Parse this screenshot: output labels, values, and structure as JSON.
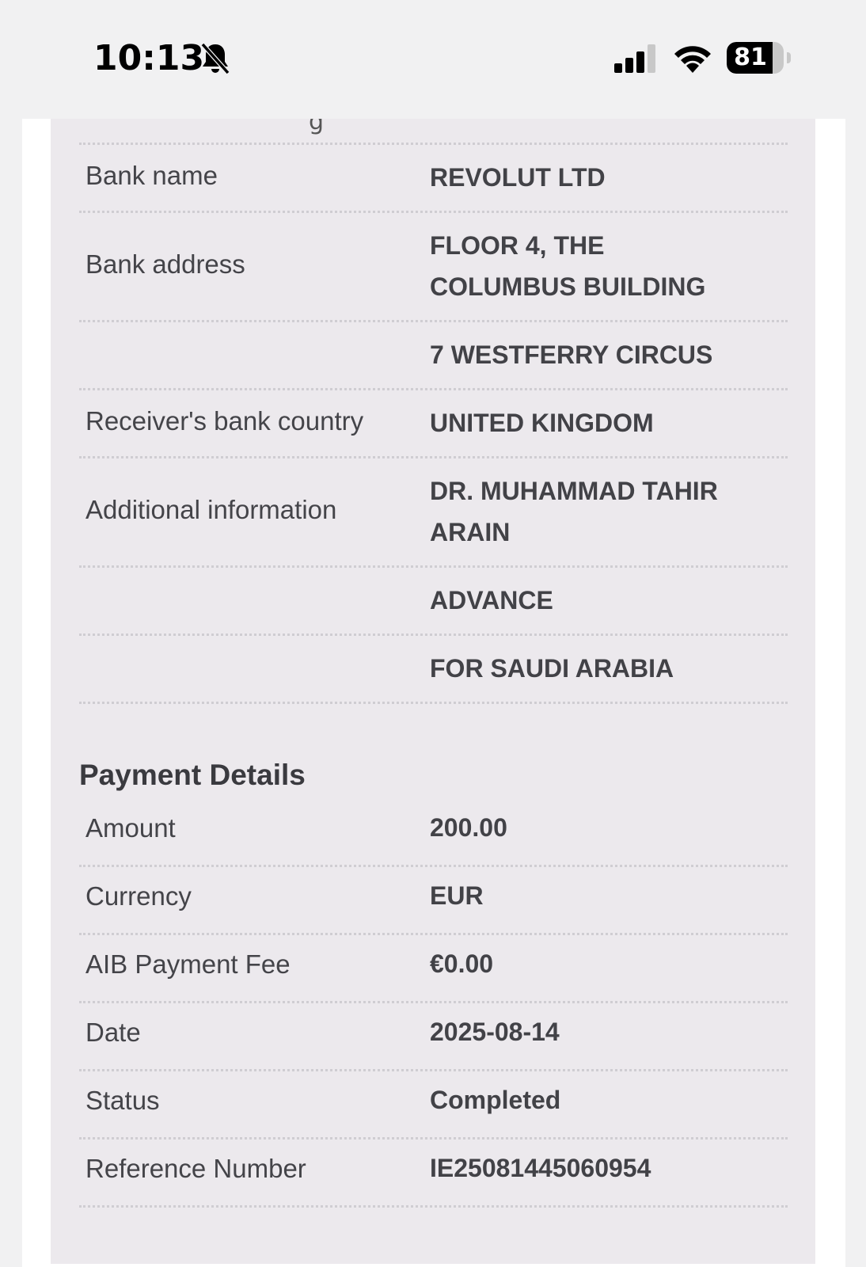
{
  "status_bar": {
    "time": "10:13",
    "battery_level": "81",
    "battery_fraction": 0.81,
    "icons": [
      "bell-off-icon",
      "signal-icon",
      "wifi-icon",
      "battery-icon"
    ]
  },
  "beneficiary_rows": [
    {
      "label": "Bank name",
      "value_lines": [
        "REVOLUT LTD"
      ]
    },
    {
      "label": "Bank address",
      "value_lines": [
        "FLOOR 4, THE",
        "COLUMBUS BUILDING"
      ]
    },
    {
      "label": "",
      "value_lines": [
        "7 WESTFERRY CIRCUS"
      ]
    },
    {
      "label": "Receiver's bank country",
      "value_lines": [
        "UNITED KINGDOM"
      ]
    },
    {
      "label": "Additional information",
      "value_lines": [
        "DR. MUHAMMAD TAHIR",
        "ARAIN"
      ]
    },
    {
      "label": "",
      "value_lines": [
        "ADVANCE"
      ]
    },
    {
      "label": "",
      "value_lines": [
        "FOR SAUDI ARABIA"
      ]
    }
  ],
  "payment_details": {
    "title": "Payment Details",
    "rows": [
      {
        "label": "Amount",
        "value": "200.00"
      },
      {
        "label": "Currency",
        "value": "EUR"
      },
      {
        "label": "AIB Payment Fee",
        "value": "€0.00"
      },
      {
        "label": "Date",
        "value": "2025-08-14"
      },
      {
        "label": "Status",
        "value": "Completed"
      },
      {
        "label": "Reference Number",
        "value": "IE25081445060954"
      }
    ]
  }
}
